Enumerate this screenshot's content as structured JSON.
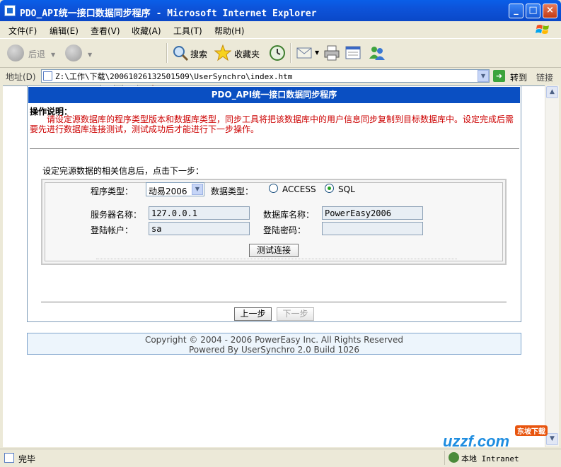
{
  "window": {
    "title": "PDO_API统一接口数据同步程序 - Microsoft Internet Explorer",
    "controls": [
      "_",
      "□",
      "×"
    ]
  },
  "menu": [
    "文件(F)",
    "编辑(E)",
    "查看(V)",
    "收藏(A)",
    "工具(T)",
    "帮助(H)"
  ],
  "toolbar": {
    "back_label": "后退",
    "search_label": "搜索",
    "favorites_label": "收藏夹"
  },
  "address": {
    "label": "地址(D)",
    "url": "Z:\\工作\\下载\\20061026132501509\\UserSynchro\\index.htm",
    "go_label": "转到",
    "links_label": "链接"
  },
  "page": {
    "header": "PDO_API统一接口数据同步程序",
    "instructions_title": "操作说明：",
    "instructions_text": "请设定源数据库的程序类型版本和数据库类型，同步工具将把该数据库中的用户信息同步复制到目标数据库中。设定完成后需要先进行数据库连接测试，测试成功后才能进行下一步操作。",
    "hint": "设定完源数据的相关信息后，点击下一步：",
    "form": {
      "program_type_label": "程序类型：",
      "program_type_value": "动易2006",
      "db_type_label": "数据类型：",
      "db_options": [
        {
          "label": "ACCESS",
          "checked": false
        },
        {
          "label": "SQL",
          "checked": true
        }
      ],
      "server_label": "服务器名称：",
      "server_value": "127.0.0.1",
      "dbname_label": "数据库名称：",
      "dbname_value": "PowerEasy2006",
      "user_label": "登陆帐户：",
      "user_value": "sa",
      "password_label": "登陆密码：",
      "password_value": "",
      "test_button": "测试连接"
    },
    "prev_button": "上一步",
    "next_button": "下一步",
    "footer_line1": "Copyright © 2004 - 2006 PowerEasy Inc. All Rights Reserved",
    "footer_line2": "Powered By UserSynchro 2.0 Build 1026"
  },
  "status": {
    "text": "完毕",
    "zone": "本地 Intranet"
  },
  "watermark": {
    "brand": "uzzf.com",
    "tag": "东坡下载"
  }
}
